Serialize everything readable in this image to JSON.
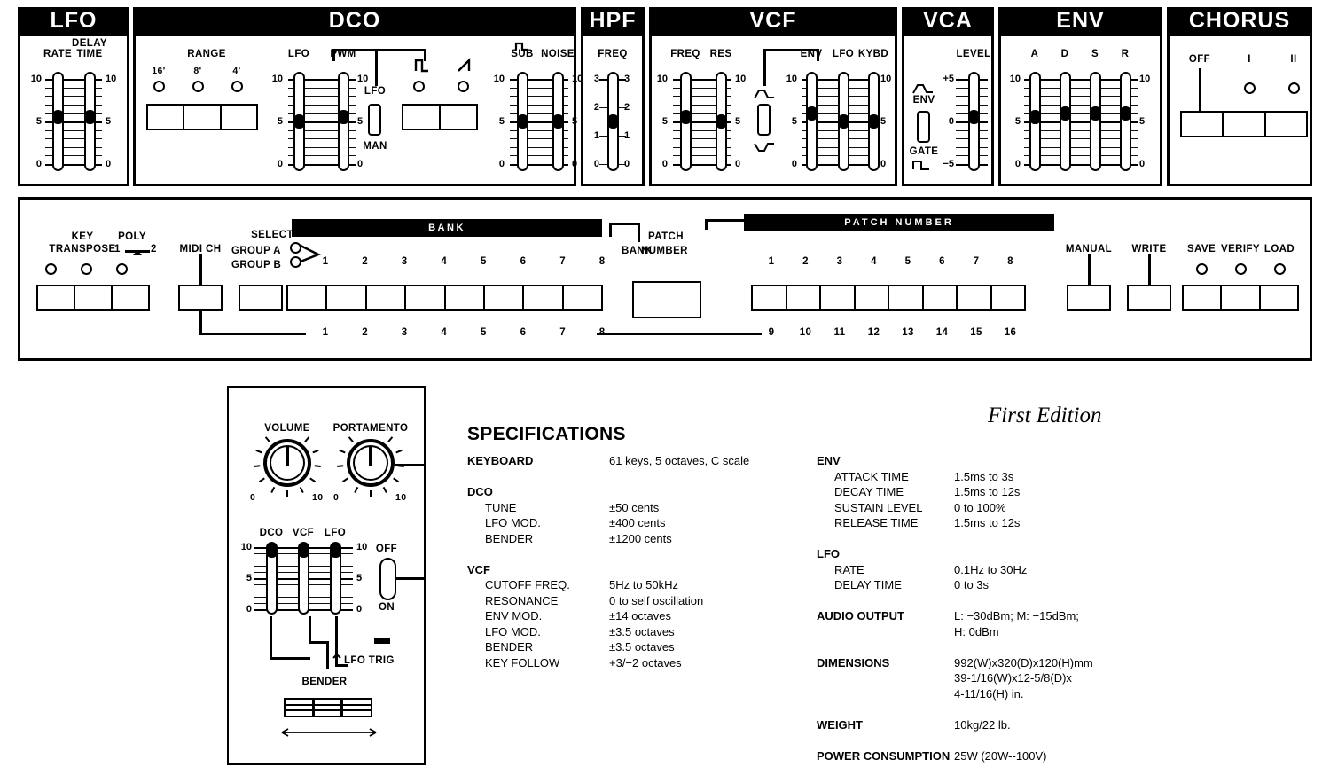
{
  "top_panel": {
    "sections": [
      {
        "title": "LFO",
        "sliders": [
          {
            "label": "RATE",
            "scale": [
              "10",
              "5",
              "0"
            ]
          },
          {
            "label": "DELAY\nTIME",
            "scale": [
              "10",
              "5",
              "0"
            ]
          }
        ]
      },
      {
        "title": "DCO",
        "range_label": "RANGE",
        "range_buttons": [
          "16'",
          "8'",
          "4'"
        ],
        "sliders": [
          {
            "label": "LFO",
            "scale": [
              "10",
              "5",
              "0"
            ]
          },
          {
            "label": "PWM",
            "scale": [
              "10",
              "5",
              "0"
            ]
          },
          {
            "label": "SUB",
            "scale": [
              "10",
              "5",
              "0"
            ]
          },
          {
            "label": "NOISE",
            "scale": [
              "10",
              "5",
              "0"
            ]
          }
        ],
        "pwm_toggle": {
          "top": "LFO",
          "bottom": "MAN"
        },
        "waveforms": [
          "pulse-wave-icon",
          "sawtooth-wave-icon"
        ],
        "sub_wave_icon": "square-wave-icon"
      },
      {
        "title": "HPF",
        "sliders": [
          {
            "label": "FREQ",
            "scale": [
              "3",
              "2",
              "1",
              "0"
            ]
          }
        ]
      },
      {
        "title": "VCF",
        "sliders": [
          {
            "label": "FREQ",
            "scale": [
              "10",
              "5",
              "0"
            ]
          },
          {
            "label": "RES",
            "scale": [
              "10",
              "5",
              "0"
            ]
          },
          {
            "label": "ENV",
            "scale": [
              "10",
              "5",
              "0"
            ]
          },
          {
            "label": "LFO",
            "scale": [
              "10",
              "5",
              "0"
            ]
          },
          {
            "label": "KYBD",
            "scale": [
              "10",
              "5",
              "0"
            ]
          }
        ],
        "env_polarity_toggle": {
          "top": "env-normal-curve-icon",
          "bottom": "env-inverted-curve-icon"
        }
      },
      {
        "title": "VCA",
        "sliders": [
          {
            "label": "LEVEL",
            "scale": [
              "+5",
              "0",
              "−5"
            ]
          }
        ],
        "mode_toggle": {
          "top": "ENV",
          "bottom": "GATE"
        }
      },
      {
        "title": "ENV",
        "sliders": [
          {
            "label": "A",
            "scale": [
              "10",
              "5",
              "0"
            ]
          },
          {
            "label": "D",
            "scale": [
              "10",
              "5",
              "0"
            ]
          },
          {
            "label": "S",
            "scale": [
              "10",
              "5",
              "0"
            ]
          },
          {
            "label": "R",
            "scale": [
              "10",
              "5",
              "0"
            ]
          }
        ]
      },
      {
        "title": "CHORUS",
        "buttons": [
          "OFF",
          "I",
          "II"
        ]
      }
    ]
  },
  "lower_panel": {
    "key_transpose": {
      "line1": "KEY",
      "line2": "TRANSPOSE"
    },
    "poly": {
      "label": "POLY",
      "left": "1",
      "right": "2"
    },
    "midi_ch": "MIDI CH",
    "select": {
      "label": "SELECT",
      "group_a": "GROUP A",
      "group_b": "GROUP B"
    },
    "bank_bar": "BANK",
    "bank_numbers_top": [
      "1",
      "2",
      "3",
      "4",
      "5",
      "6",
      "7",
      "8"
    ],
    "bank_numbers_bottom": [
      "1",
      "2",
      "3",
      "4",
      "5",
      "6",
      "7",
      "8"
    ],
    "bank_number_label": {
      "line1": "BANK",
      "line2": "NUMBER"
    },
    "patch_label": {
      "line1": "PATCH",
      "line2": "NUMBER"
    },
    "patch_bar": "PATCH NUMBER",
    "patch_numbers_top": [
      "1",
      "2",
      "3",
      "4",
      "5",
      "6",
      "7",
      "8"
    ],
    "patch_numbers_bottom": [
      "9",
      "10",
      "11",
      "12",
      "13",
      "14",
      "15",
      "16"
    ],
    "manual": "MANUAL",
    "write": "WRITE",
    "tape": [
      "SAVE",
      "VERIFY",
      "LOAD"
    ]
  },
  "detail_panel": {
    "knobs": [
      {
        "label": "VOLUME",
        "min": "0",
        "max": "10"
      },
      {
        "label": "PORTAMENTO",
        "min": "0",
        "max": "10"
      }
    ],
    "sliders": [
      {
        "label": "DCO",
        "scale": [
          "10",
          "5",
          "0"
        ]
      },
      {
        "label": "VCF",
        "scale": [
          "10",
          "5",
          "0"
        ]
      },
      {
        "label": "LFO",
        "scale": [
          "10",
          "5",
          "0"
        ]
      }
    ],
    "portamento_switch": {
      "top": "OFF",
      "bottom": "ON"
    },
    "lfo_trig": "LFO TRIG",
    "bender": "BENDER"
  },
  "specifications": {
    "title": "SPECIFICATIONS",
    "first_edition": "First Edition",
    "left_column": [
      {
        "key": "KEYBOARD",
        "value": "61 keys, 5 octaves, C scale",
        "sub": false
      },
      {
        "key": "",
        "value": "",
        "sub": false
      },
      {
        "key": "DCO",
        "value": "",
        "sub": false
      },
      {
        "key": "TUNE",
        "value": "±50 cents",
        "sub": true
      },
      {
        "key": "LFO MOD.",
        "value": "±400 cents",
        "sub": true
      },
      {
        "key": "BENDER",
        "value": "±1200 cents",
        "sub": true
      },
      {
        "key": "",
        "value": "",
        "sub": false
      },
      {
        "key": "VCF",
        "value": "",
        "sub": false
      },
      {
        "key": "CUTOFF FREQ.",
        "value": "5Hz to 50kHz",
        "sub": true
      },
      {
        "key": "RESONANCE",
        "value": "0 to self oscillation",
        "sub": true
      },
      {
        "key": "ENV MOD.",
        "value": "±14 octaves",
        "sub": true
      },
      {
        "key": "LFO MOD.",
        "value": "±3.5 octaves",
        "sub": true
      },
      {
        "key": "BENDER",
        "value": "±3.5 octaves",
        "sub": true
      },
      {
        "key": "KEY FOLLOW",
        "value": "+3/−2 octaves",
        "sub": true
      }
    ],
    "right_column": [
      {
        "key": "ENV",
        "value": "",
        "sub": false
      },
      {
        "key": "ATTACK TIME",
        "value": "1.5ms to 3s",
        "sub": true
      },
      {
        "key": "DECAY TIME",
        "value": "1.5ms to 12s",
        "sub": true
      },
      {
        "key": "SUSTAIN LEVEL",
        "value": "0 to 100%",
        "sub": true
      },
      {
        "key": "RELEASE TIME",
        "value": "1.5ms to 12s",
        "sub": true
      },
      {
        "key": "",
        "value": "",
        "sub": false
      },
      {
        "key": "LFO",
        "value": "",
        "sub": false
      },
      {
        "key": "RATE",
        "value": "0.1Hz to 30Hz",
        "sub": true
      },
      {
        "key": "DELAY TIME",
        "value": "0 to 3s",
        "sub": true
      },
      {
        "key": "",
        "value": "",
        "sub": false
      },
      {
        "key": "AUDIO OUTPUT",
        "value": "L: −30dBm;  M: −15dBm;",
        "sub": false
      },
      {
        "key": "",
        "value": "H: 0dBm",
        "sub": false
      },
      {
        "key": "",
        "value": "",
        "sub": false
      },
      {
        "key": "DIMENSIONS",
        "value": "992(W)x320(D)x120(H)mm",
        "sub": false
      },
      {
        "key": "",
        "value": "39-1/16(W)x12-5/8(D)x",
        "sub": false
      },
      {
        "key": "",
        "value": "4-11/16(H) in.",
        "sub": false
      },
      {
        "key": "",
        "value": "",
        "sub": false
      },
      {
        "key": "WEIGHT",
        "value": "10kg/22 lb.",
        "sub": false
      },
      {
        "key": "",
        "value": "",
        "sub": false
      },
      {
        "key": "POWER CONSUMPTION",
        "value": "25W (20W--100V)",
        "sub": false
      }
    ]
  }
}
